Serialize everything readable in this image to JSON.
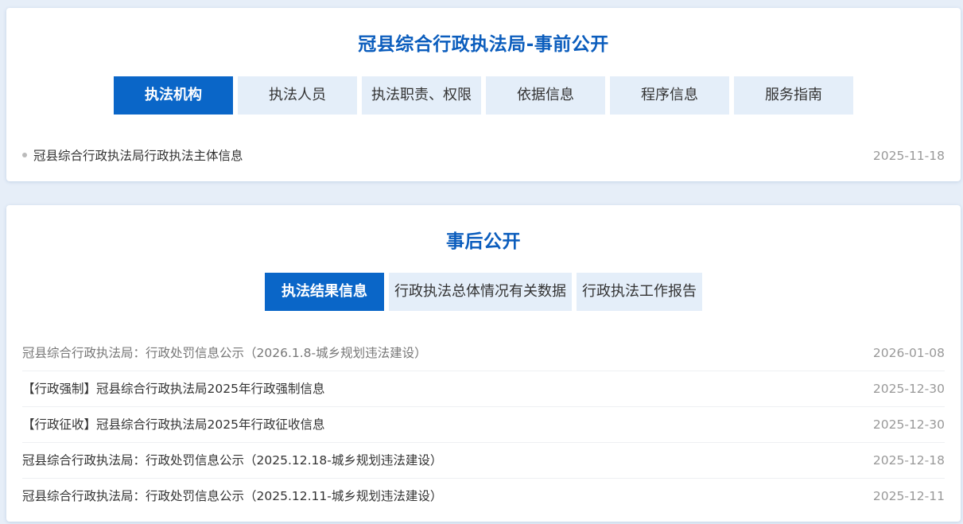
{
  "before": {
    "title": "冠县综合行政执法局-事前公开",
    "tabs": [
      {
        "label": "执法机构",
        "active": true
      },
      {
        "label": "执法人员",
        "active": false
      },
      {
        "label": "执法职责、权限",
        "active": false
      },
      {
        "label": "依据信息",
        "active": false
      },
      {
        "label": "程序信息",
        "active": false
      },
      {
        "label": "服务指南",
        "active": false
      }
    ],
    "items": [
      {
        "title": "冠县综合行政执法局行政执法主体信息",
        "date": "2025-11-18"
      }
    ]
  },
  "after": {
    "title": "事后公开",
    "tabs": [
      {
        "label": "执法结果信息",
        "active": true
      },
      {
        "label": "行政执法总体情况有关数据",
        "active": false
      },
      {
        "label": "行政执法工作报告",
        "active": false
      }
    ],
    "items": [
      {
        "title": "冠县综合行政执法局：行政处罚信息公示（2026.1.8-城乡规划违法建设）",
        "date": "2026-01-08"
      },
      {
        "title": "【行政强制】冠县综合行政执法局2025年行政强制信息",
        "date": "2025-12-30"
      },
      {
        "title": "【行政征收】冠县综合行政执法局2025年行政征收信息",
        "date": "2025-12-30"
      },
      {
        "title": "冠县综合行政执法局：行政处罚信息公示（2025.12.18-城乡规划违法建设）",
        "date": "2025-12-18"
      },
      {
        "title": "冠县综合行政执法局：行政处罚信息公示（2025.12.11-城乡规划违法建设）",
        "date": "2025-12-11"
      }
    ]
  },
  "colors": {
    "accent": "#0a66c8",
    "title": "#0b5dbd",
    "tab_bg": "#e4eef9",
    "page_bg": "#e6eef8"
  }
}
